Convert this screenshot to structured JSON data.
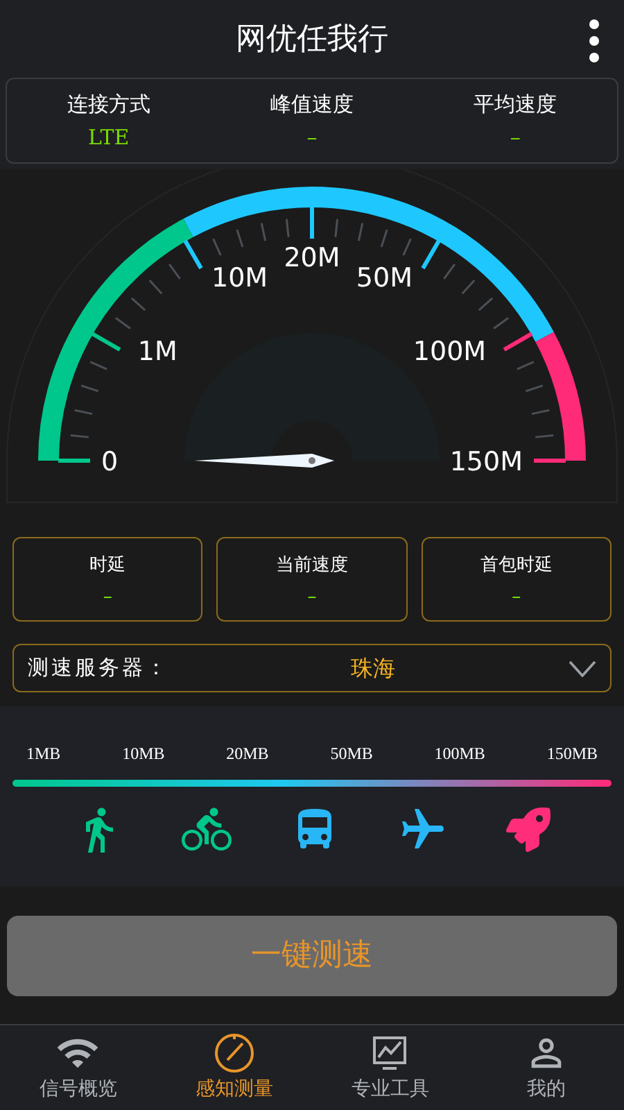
{
  "title": "网优任我行",
  "summary": [
    {
      "label": "连接方式",
      "value": "LTE"
    },
    {
      "label": "峰值速度",
      "value": "–"
    },
    {
      "label": "平均速度",
      "value": "–"
    }
  ],
  "gauge": {
    "labels": [
      "0",
      "1M",
      "10M",
      "20M",
      "50M",
      "100M",
      "150M"
    ]
  },
  "metrics": [
    {
      "label": "时延",
      "value": "–"
    },
    {
      "label": "当前速度",
      "value": "–"
    },
    {
      "label": "首包时延",
      "value": "–"
    }
  ],
  "server": {
    "label": "测速服务器：",
    "value": "珠海"
  },
  "scale": {
    "labels": [
      "1MB",
      "10MB",
      "20MB",
      "50MB",
      "100MB",
      "150MB"
    ],
    "modes": [
      {
        "kind": "walk",
        "color": "#00c78c"
      },
      {
        "kind": "bike",
        "color": "#00c78c"
      },
      {
        "kind": "bus",
        "color": "#29b6f6"
      },
      {
        "kind": "plane",
        "color": "#29b6f6"
      },
      {
        "kind": "rocket",
        "color": "#ff2d7a"
      }
    ]
  },
  "start_button": "一键测速",
  "nav": [
    {
      "kind": "wifi",
      "label": "信号概览",
      "selected": false
    },
    {
      "kind": "gauge",
      "label": "感知测量",
      "selected": true
    },
    {
      "kind": "tools",
      "label": "专业工具",
      "selected": false
    },
    {
      "kind": "person",
      "label": "我的",
      "selected": false
    }
  ]
}
